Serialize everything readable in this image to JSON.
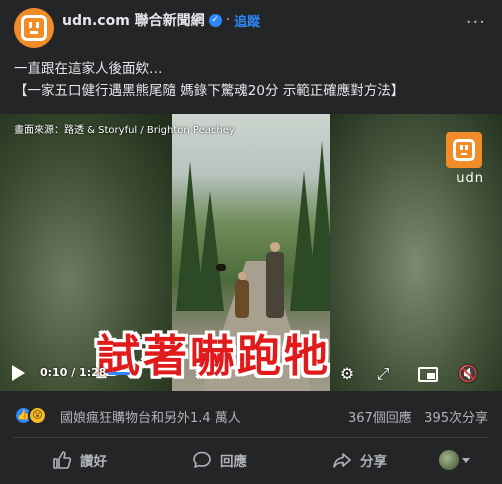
{
  "header": {
    "page_name": "udn.com 聯合新聞網",
    "follow_label": "追蹤",
    "more_label": "···"
  },
  "post": {
    "line1": "一直跟在這家人後面欸…",
    "line2": "【一家五口健行遇黑熊尾隨 媽錄下驚魂20分 示範正確應對方法】"
  },
  "video": {
    "source_caption": "畫面來源：路透 & Storyful / Brighton Peachey",
    "logo_text": "udn",
    "subtitle": "試著嚇跑牠",
    "time": "0:10 / 1:28",
    "progress_fraction": 0.114
  },
  "reactions": {
    "reactors": "國娘瘋狂購物台和另外1.4 萬人",
    "comments": "367個回應",
    "shares": "395次分享"
  },
  "actions": {
    "like": "讚好",
    "comment": "回應",
    "share": "分享"
  },
  "colors": {
    "background": "#242526",
    "accent": "#2d88ff",
    "brand": "#f28c28",
    "subtitle_red": "#e11b1b"
  },
  "icons": [
    "udn-logo-icon",
    "verified-icon",
    "more-icon",
    "play-icon",
    "gear-icon",
    "expand-icon",
    "pip-icon",
    "volume-icon",
    "like-reaction-icon",
    "wow-reaction-icon",
    "thumbs-up-icon",
    "comment-icon",
    "share-icon",
    "chevron-down-icon"
  ]
}
